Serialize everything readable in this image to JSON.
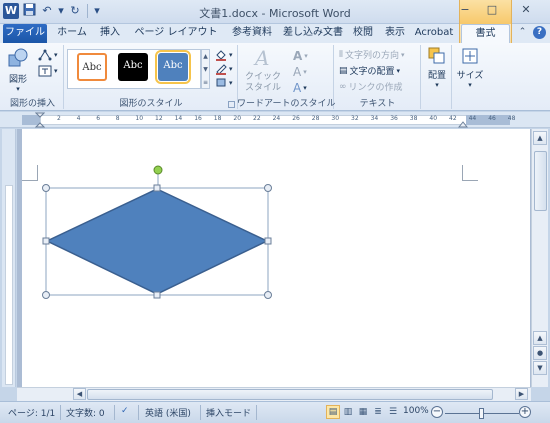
{
  "window": {
    "title": "文書1.docx - Microsoft Word",
    "word_icon": "W",
    "minimize": "−",
    "maximize": "□",
    "close": "✕"
  },
  "qat": {
    "save_icon": "save-icon",
    "undo": "↶",
    "redo": "↻",
    "customize": "▾"
  },
  "tabs": [
    {
      "label": "ファイル"
    },
    {
      "label": "ホーム"
    },
    {
      "label": "挿入"
    },
    {
      "label": "ページ レイアウト"
    },
    {
      "label": "参考資料"
    },
    {
      "label": "差し込み文書"
    },
    {
      "label": "校閲"
    },
    {
      "label": "表示"
    },
    {
      "label": "Acrobat"
    },
    {
      "label": "書式"
    }
  ],
  "ribbon_right": {
    "collapse": "⌃",
    "help": "?"
  },
  "ribbon": {
    "insert_shapes": {
      "label": "図形の挿入",
      "shapes_btn": "図形"
    },
    "shape_styles": {
      "label": "図形のスタイル",
      "thumbs": [
        "Abc",
        "Abc",
        "Abc"
      ]
    },
    "wordart": {
      "label": "ワードアートのスタイル",
      "quick_styles": "クイック\nスタイル"
    },
    "text": {
      "label": "テキスト",
      "direction": "文字列の方向",
      "align": "文字の配置",
      "link": "リンクの作成"
    },
    "arrange": {
      "label": "配置"
    },
    "size": {
      "label": "サイズ"
    }
  },
  "ruler": {
    "numbers": [
      "2",
      "4",
      "6",
      "8",
      "10",
      "12",
      "14",
      "16",
      "18",
      "20",
      "22",
      "24",
      "26",
      "28",
      "30",
      "32",
      "34",
      "36",
      "38",
      "40",
      "42",
      "44",
      "46",
      "48"
    ]
  },
  "shape": {
    "type": "diamond",
    "fill": "#4f81bd",
    "stroke": "#3a5f8f"
  },
  "status": {
    "page": "ページ: 1/1",
    "words": "文字数: 0",
    "lang": "英語 (米国)",
    "mode": "挿入モード",
    "zoom": "100%",
    "zoom_out": "−",
    "zoom_in": "+"
  },
  "colors": {
    "accent": "#2b579a",
    "context_tab": "#f6dca4"
  }
}
